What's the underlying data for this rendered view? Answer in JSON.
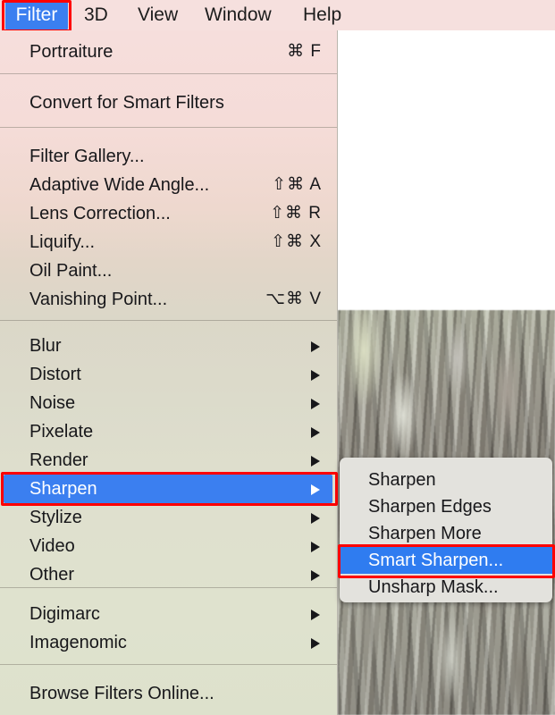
{
  "menubar": {
    "items": [
      {
        "label": "Filter",
        "selected": true
      },
      {
        "label": "3D",
        "selected": false
      },
      {
        "label": "View",
        "selected": false
      },
      {
        "label": "Window",
        "selected": false
      },
      {
        "label": "Help",
        "selected": false
      }
    ]
  },
  "filter_menu": {
    "items": [
      {
        "label": "Portraiture",
        "shortcut": "⌘ F",
        "arrow": false
      },
      {
        "label": "Convert for Smart Filters",
        "shortcut": "",
        "arrow": false
      },
      {
        "label": "Filter Gallery...",
        "shortcut": "",
        "arrow": false
      },
      {
        "label": "Adaptive Wide Angle...",
        "shortcut": "⇧⌘ A",
        "arrow": false
      },
      {
        "label": "Lens Correction...",
        "shortcut": "⇧⌘ R",
        "arrow": false
      },
      {
        "label": "Liquify...",
        "shortcut": "⇧⌘ X",
        "arrow": false
      },
      {
        "label": "Oil Paint...",
        "shortcut": "",
        "arrow": false
      },
      {
        "label": "Vanishing Point...",
        "shortcut": "⌥⌘ V",
        "arrow": false
      },
      {
        "label": "Blur",
        "shortcut": "",
        "arrow": true
      },
      {
        "label": "Distort",
        "shortcut": "",
        "arrow": true
      },
      {
        "label": "Noise",
        "shortcut": "",
        "arrow": true
      },
      {
        "label": "Pixelate",
        "shortcut": "",
        "arrow": true
      },
      {
        "label": "Render",
        "shortcut": "",
        "arrow": true
      },
      {
        "label": "Sharpen",
        "shortcut": "",
        "arrow": true,
        "selected": true
      },
      {
        "label": "Stylize",
        "shortcut": "",
        "arrow": true
      },
      {
        "label": "Video",
        "shortcut": "",
        "arrow": true
      },
      {
        "label": "Other",
        "shortcut": "",
        "arrow": true
      },
      {
        "label": "Digimarc",
        "shortcut": "",
        "arrow": true
      },
      {
        "label": "Imagenomic",
        "shortcut": "",
        "arrow": true
      },
      {
        "label": "Browse Filters Online...",
        "shortcut": "",
        "arrow": false
      }
    ]
  },
  "sharpen_submenu": {
    "items": [
      {
        "label": "Sharpen",
        "selected": false
      },
      {
        "label": "Sharpen Edges",
        "selected": false
      },
      {
        "label": "Sharpen More",
        "selected": false
      },
      {
        "label": "Smart Sharpen...",
        "selected": true
      },
      {
        "label": "Unsharp Mask...",
        "selected": false
      }
    ]
  },
  "annotations": {
    "highlight_color": "#ff0000",
    "selection_color": "#3b7ff0"
  }
}
